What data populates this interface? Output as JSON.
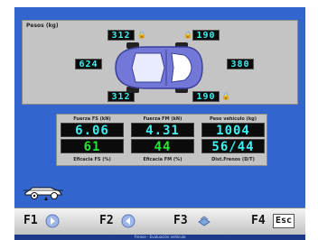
{
  "weights": {
    "title": "Pesos (kg)",
    "front_left": "312",
    "front_right": "190",
    "left": "624",
    "right": "380",
    "rear_left": "312",
    "rear_right": "190"
  },
  "gauges": {
    "fs_label": "Fuerza FS (kN)",
    "fs_value": "6.06",
    "fm_label": "Fuerza FM (kN)",
    "fm_value": "4.31",
    "weight_label": "Peso vehículo (kg)",
    "weight_value": "1004",
    "eff_fs_value": "61",
    "eff_fs_label": "Eficacia FS (%)",
    "eff_fm_value": "44",
    "eff_fm_label": "Eficacia FM (%)",
    "dist_value": "56/44",
    "dist_label": "Dist.Frenos (D/T)"
  },
  "function_keys": {
    "f1": "F1",
    "f2": "F2",
    "f3": "F3",
    "f4": "F4",
    "esc": "Esc"
  },
  "status_bar": {
    "text": "Frenos - Evaluación vehículo"
  },
  "colors": {
    "screen_bg": "#3366cc",
    "panel": "#c4c4c4",
    "lcd_cyan": "#3ef0f0",
    "lcd_green": "#23e833"
  },
  "icons": [
    "lock-icon",
    "car-top-view-icon",
    "brake-car-icon",
    "help-icon",
    "back-icon",
    "print-icon",
    "escape-icon"
  ]
}
